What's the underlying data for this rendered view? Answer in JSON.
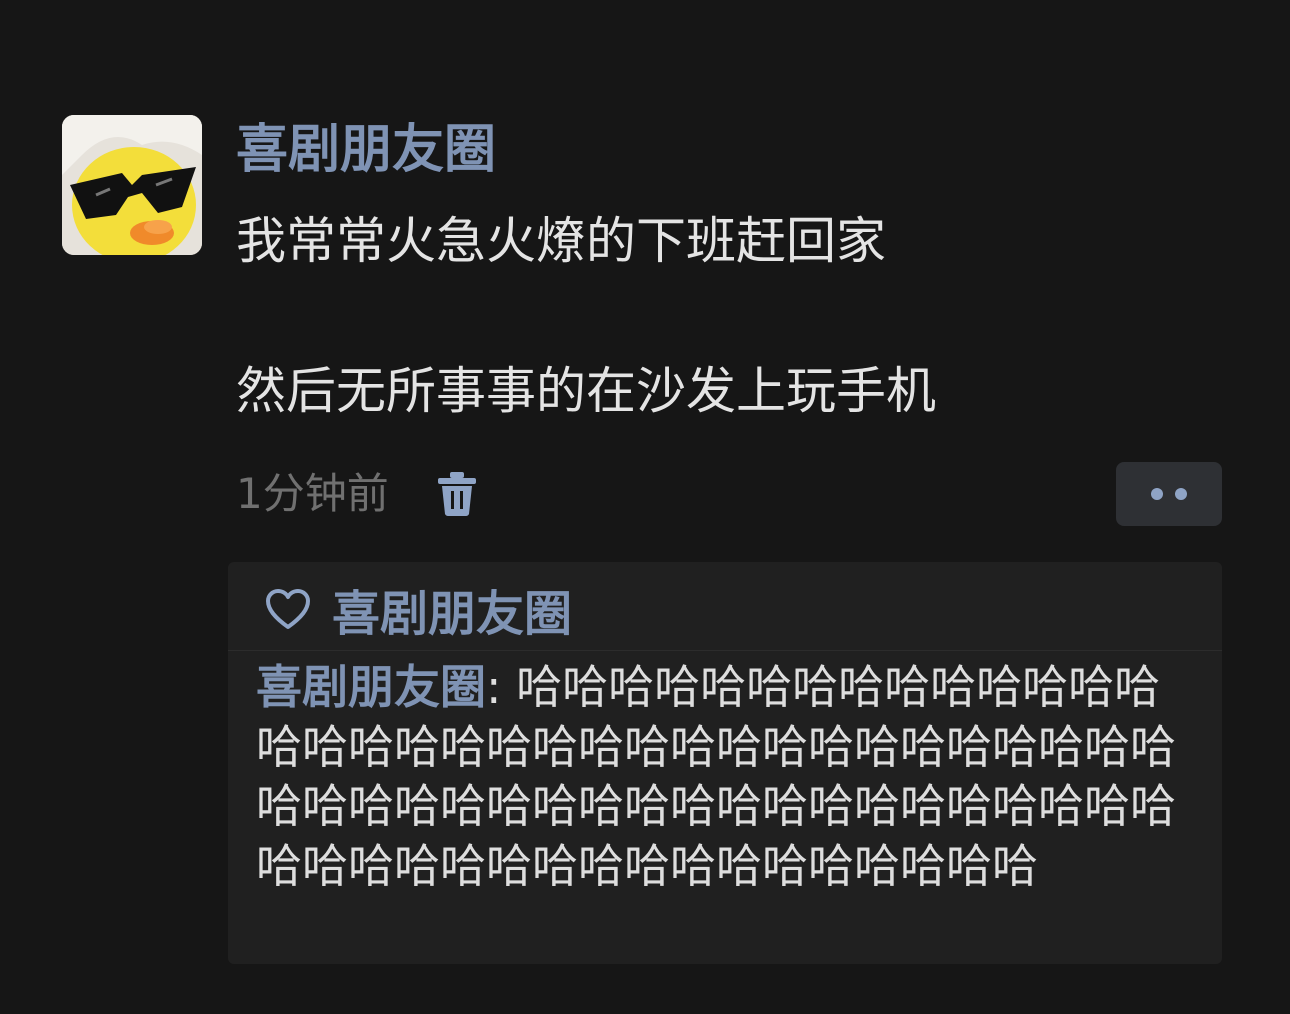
{
  "post": {
    "author": "喜剧朋友圈",
    "text_line1": "我常常火急火燎的下班赶回家",
    "text_line2": "然后无所事事的在沙发上玩手机",
    "time": "1分钟前"
  },
  "likes": {
    "names": "喜剧朋友圈"
  },
  "comment": {
    "author": "喜剧朋友圈",
    "separator": ": ",
    "text": "哈哈哈哈哈哈哈哈哈哈哈哈哈哈哈哈哈哈哈哈哈哈哈哈哈哈哈哈哈哈哈哈哈哈哈哈哈哈哈哈哈哈哈哈哈哈哈哈哈哈哈哈哈哈哈哈哈哈哈哈哈哈哈哈哈哈哈哈哈哈哈"
  },
  "icons": {
    "avatar": "duck-with-sunglasses-avatar",
    "delete": "trash-icon",
    "more": "more-dots-icon",
    "like": "heart-icon"
  },
  "colors": {
    "background": "#161616",
    "name_blue": "#7f93b4",
    "text": "#e4e4e4",
    "muted": "#707070",
    "comment_box": "#202020"
  }
}
